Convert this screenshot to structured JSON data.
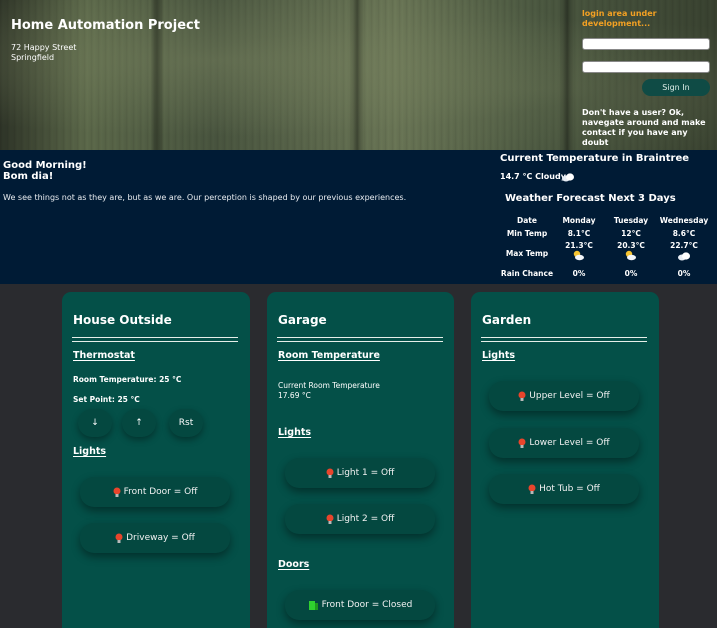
{
  "header": {
    "site_title": "Home Automation Project",
    "address_line1": "72 Happy Street",
    "address_line2": "Springfield",
    "login_note": "login area under development...",
    "username_placeholder": "",
    "password_placeholder": "",
    "signin_label": "Sign In",
    "signup_note": "Don't have a user? Ok, navegate around and make contact if you have any doubt"
  },
  "info": {
    "greeting_en": "Good Morning!",
    "greeting_pt": "Bom dia!",
    "quote": "We see things not as they are, but as we are. Our perception is shaped by our previous experiences.",
    "current_temp_title": "Current Temperature in Braintree",
    "current_temp_value": "14.7 °C Cloudy",
    "current_icon": "cloud-icon",
    "forecast_title": "Weather Forecast Next 3 Days",
    "forecast": {
      "labels": {
        "date": "Date",
        "min": "Min Temp",
        "max": "Max Temp",
        "rain": "Rain Chance"
      },
      "days": [
        {
          "day": "Monday",
          "min": "8.1°C",
          "max": "21.3°C",
          "icon": "sun-cloud-icon",
          "rain": "0%"
        },
        {
          "day": "Tuesday",
          "min": "12°C",
          "max": "20.3°C",
          "icon": "sun-cloud-icon",
          "rain": "0%"
        },
        {
          "day": "Wednesday",
          "min": "8.6°C",
          "max": "22.7°C",
          "icon": "cloud-icon",
          "rain": "0%"
        }
      ]
    }
  },
  "cards": {
    "house": {
      "title": "House Outside",
      "thermostat_title": "Thermostat",
      "room_temp": "Room Temperature: 25 °C",
      "set_point": "Set Point: 25 °C",
      "down_icon": "arrow-down-icon",
      "up_icon": "arrow-up-icon",
      "down_label": "↓",
      "up_label": "↑",
      "reset_label": "Rst",
      "lights_title": "Lights",
      "lights": [
        "Front Door = Off",
        "Driveway = Off"
      ]
    },
    "garage": {
      "title": "Garage",
      "room_temp_title": "Room Temperature",
      "room_temp_caption": "Current Room Temperature",
      "room_temp_value": "17.69 °C",
      "lights_title": "Lights",
      "lights": [
        "Light 1 = Off",
        "Light 2 = Off"
      ],
      "doors_title": "Doors",
      "doors": [
        "Front Door = Closed"
      ]
    },
    "garden": {
      "title": "Garden",
      "lights_title": "Lights",
      "lights": [
        "Upper Level = Off",
        "Lower Level = Off",
        "Hot Tub = Off"
      ]
    }
  },
  "colors": {
    "info_bg": "#001b35",
    "card_bg": "#045048",
    "page_bg": "#2a2b2f",
    "login_note": "#f2a023",
    "bulb_off": "#e8452c",
    "door_closed": "#2fd12f"
  }
}
